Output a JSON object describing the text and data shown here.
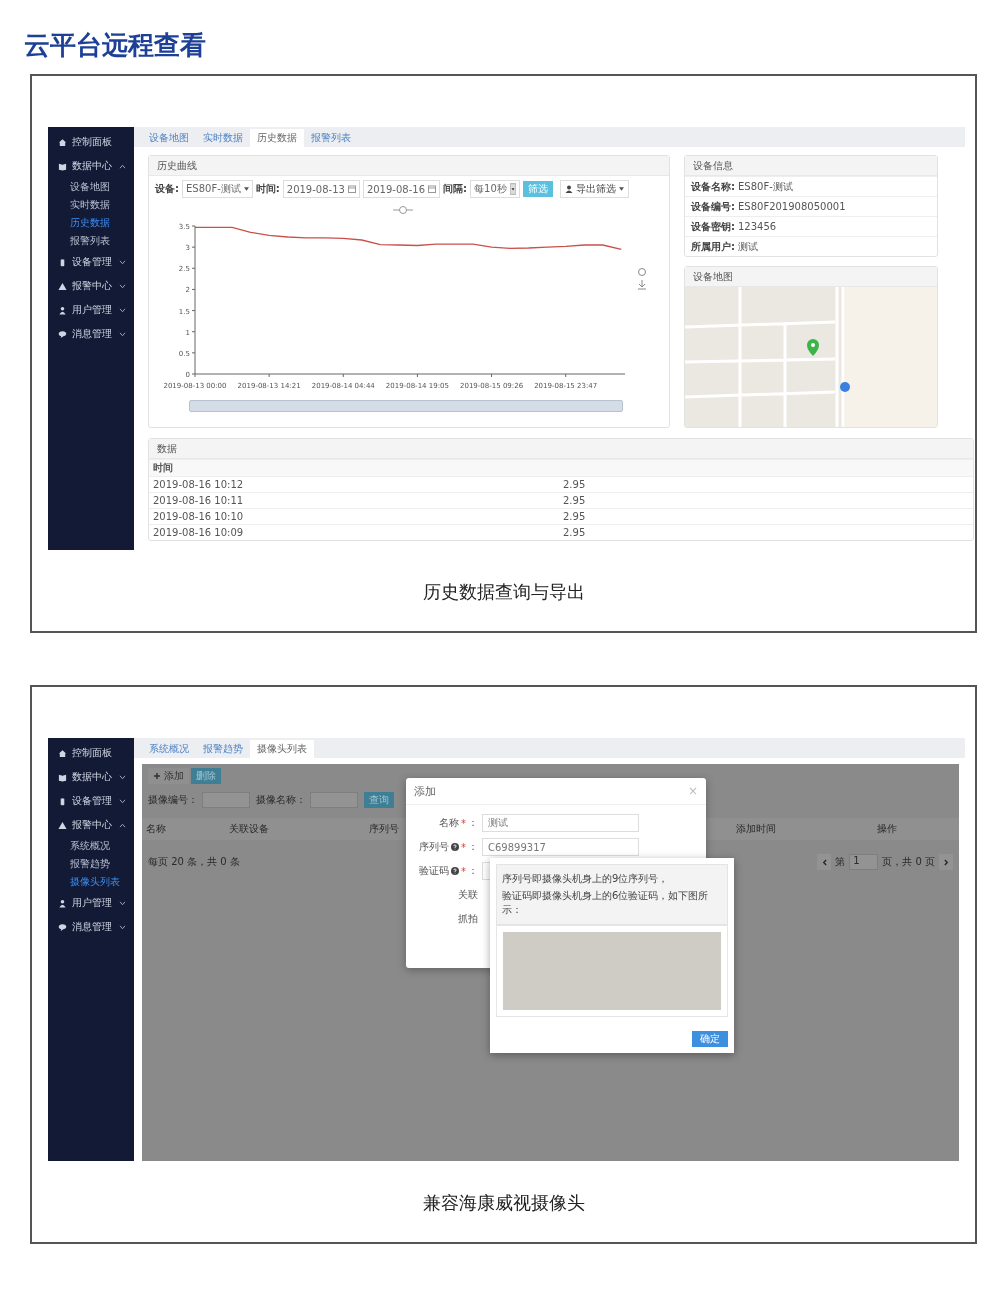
{
  "title": "云平台远程查看",
  "history_panel": {
    "sidebar": [
      {
        "label": "控制面板"
      },
      {
        "label": "数据中心",
        "expanded": true,
        "children": [
          {
            "label": "设备地图",
            "selected": false
          },
          {
            "label": "实时数据",
            "selected": false
          },
          {
            "label": "历史数据",
            "selected": true
          },
          {
            "label": "报警列表",
            "selected": false
          }
        ]
      },
      {
        "label": "设备管理",
        "expanded": false
      },
      {
        "label": "报警中心",
        "expanded": false
      },
      {
        "label": "用户管理",
        "expanded": false
      },
      {
        "label": "消息管理",
        "expanded": false
      }
    ],
    "tabs": [
      {
        "label": "设备地图",
        "selected": false
      },
      {
        "label": "实时数据",
        "selected": false
      },
      {
        "label": "历史数据",
        "selected": true
      },
      {
        "label": "报警列表",
        "selected": false
      }
    ],
    "chart_card": {
      "title": "历史曲线",
      "device_label": "设备:",
      "device_value": "ES80F-测试",
      "time_label": "时间:",
      "date_from": "2019-08-13",
      "date_to": "2019-08-16",
      "interval_label": "间隔:",
      "interval_value": "每10秒",
      "filter_button": "筛选",
      "export_button": "导出筛选",
      "chart_data": {
        "type": "line",
        "categories": [
          "2019-08-13 00:00",
          null,
          null,
          null,
          "2019-08-13 14:21",
          null,
          null,
          null,
          "2019-08-14 04:44",
          null,
          null,
          null,
          "2019-08-14 19:05",
          null,
          null,
          null,
          "2019-08-15 09:26",
          null,
          null,
          null,
          "2019-08-15 23:47",
          null,
          null,
          null
        ],
        "series": [
          {
            "color": "#c9504b",
            "values": [
              3.47,
              3.47,
              3.47,
              3.35,
              3.28,
              3.24,
              3.22,
              3.22,
              3.21,
              3.17,
              3.06,
              3.05,
              3.04,
              3.07,
              3.07,
              3.07,
              3.0,
              2.97,
              2.98,
              3.0,
              3.02,
              3.05,
              3.05,
              2.95
            ]
          }
        ],
        "ylim": [
          0,
          3.5
        ],
        "yticks": [
          0,
          0.5,
          1,
          1.5,
          2,
          2.5,
          3,
          3.5
        ]
      }
    },
    "info_card": {
      "title": "设备信息",
      "rows": [
        {
          "label": "设备名称:",
          "value": "ES80F-测试"
        },
        {
          "label": "设备编号:",
          "value": "ES80F201908050001"
        },
        {
          "label": "设备密钥:",
          "value": "123456"
        },
        {
          "label": "所属用户:",
          "value": "测试"
        }
      ]
    },
    "map_card": {
      "title": "设备地图"
    },
    "data_card": {
      "title": "数据",
      "columns": [
        "时间"
      ],
      "rows": [
        {
          "time": "2019-08-16 10:12",
          "value": "2.95"
        },
        {
          "time": "2019-08-16 10:11",
          "value": "2.95"
        },
        {
          "time": "2019-08-16 10:10",
          "value": "2.95"
        },
        {
          "time": "2019-08-16 10:09",
          "value": "2.95"
        }
      ]
    },
    "caption": "历史数据查询与导出"
  },
  "camera_panel": {
    "sidebar": [
      {
        "label": "控制面板"
      },
      {
        "label": "数据中心",
        "expanded": false
      },
      {
        "label": "设备管理",
        "expanded": false
      },
      {
        "label": "报警中心",
        "expanded": true,
        "children": [
          {
            "label": "系统概况",
            "selected": false
          },
          {
            "label": "报警趋势",
            "selected": false
          },
          {
            "label": "摄像头列表",
            "selected": true
          }
        ]
      },
      {
        "label": "用户管理",
        "expanded": false
      },
      {
        "label": "消息管理",
        "expanded": false
      }
    ],
    "tabs": [
      {
        "label": "系统概况",
        "selected": false
      },
      {
        "label": "报警趋势",
        "selected": false
      },
      {
        "label": "摄像头列表",
        "selected": true
      }
    ],
    "add_button": "添加",
    "delete_button": "删除",
    "search_fields": [
      {
        "label": "摄像编号："
      },
      {
        "label": "摄像名称："
      }
    ],
    "search_button": "查询",
    "columns": [
      "名称",
      "关联设备",
      "序列号",
      "添加时间",
      "操作"
    ],
    "footer": "每页 20 条，共 0 条",
    "pagination": {
      "prefix": "第",
      "page": "1",
      "suffix": "页，共 0 页"
    },
    "dialog": {
      "title": "添加",
      "close": "×",
      "fields": [
        {
          "label": "名称",
          "help": false,
          "required_mark": "*",
          "colon": "：",
          "value": "测试"
        },
        {
          "label": "序列号",
          "help": true,
          "required_mark": "*",
          "colon": "：",
          "value": "C69899317"
        },
        {
          "label": "验证码",
          "help": true,
          "required_mark": "*",
          "colon": "："
        },
        {
          "label": "关联",
          "help": false
        },
        {
          "label": "抓拍",
          "help": false
        }
      ]
    },
    "popover": {
      "lines": [
        "序列号即摄像头机身上的9位序列号，",
        "验证码即摄像头机身上的6位验证码，如下图所示："
      ],
      "confirm_button": "确定"
    },
    "caption": "兼容海康威视摄像头"
  }
}
